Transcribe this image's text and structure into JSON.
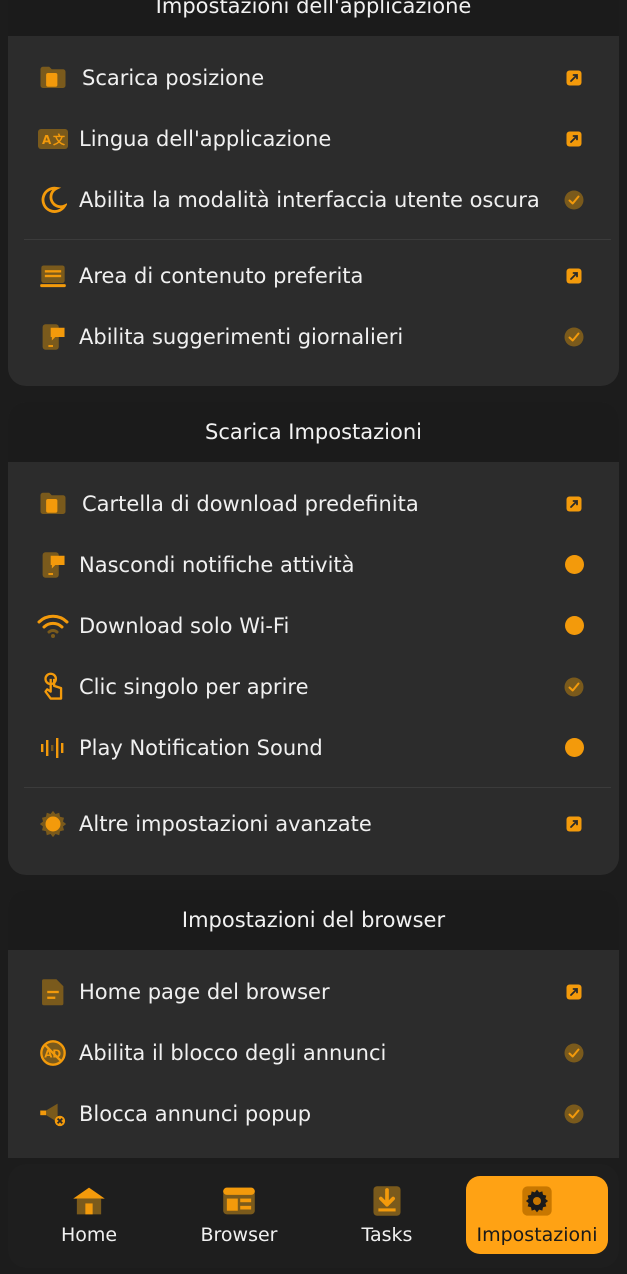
{
  "app_settings": {
    "header": "Impostazioni dell'applicazione",
    "items": [
      {
        "label": "Scarica posizione",
        "icon": "folder-icon",
        "action": "edit"
      },
      {
        "label": "Lingua dell'applicazione",
        "icon": "translate-icon",
        "action": "edit"
      },
      {
        "label": "Abilita la modalità interfaccia utente oscura",
        "icon": "moon-icon",
        "action": "check"
      },
      {
        "label": "Area di contenuto preferita",
        "icon": "content-area-icon",
        "action": "edit"
      },
      {
        "label": "Abilita suggerimenti giornalieri",
        "icon": "phone-tips-icon",
        "action": "check"
      }
    ]
  },
  "download_settings": {
    "header": "Scarica Impostazioni",
    "items": [
      {
        "label": "Cartella di download predefinita",
        "icon": "folder-icon",
        "action": "edit"
      },
      {
        "label": "Nascondi notifiche attività",
        "icon": "phone-notification-icon",
        "action": "dot"
      },
      {
        "label": "Download solo Wi-Fi",
        "icon": "wifi-icon",
        "action": "dot"
      },
      {
        "label": "Clic singolo per aprire",
        "icon": "tap-icon",
        "action": "check"
      },
      {
        "label": "Play Notification Sound",
        "icon": "sound-wave-icon",
        "action": "dot"
      },
      {
        "label": "Altre impostazioni avanzate",
        "icon": "gear-icon",
        "action": "edit"
      }
    ]
  },
  "browser_settings": {
    "header": "Impostazioni del browser",
    "items": [
      {
        "label": "Home page del browser",
        "icon": "document-icon",
        "action": "edit"
      },
      {
        "label": "Abilita il blocco degli annunci",
        "icon": "ad-block-icon",
        "action": "check"
      },
      {
        "label": "Blocca annunci popup",
        "icon": "megaphone-block-icon",
        "action": "check"
      }
    ]
  },
  "nav": {
    "items": [
      {
        "label": "Home",
        "icon": "home-icon"
      },
      {
        "label": "Browser",
        "icon": "browser-icon"
      },
      {
        "label": "Tasks",
        "icon": "download-tasks-icon"
      },
      {
        "label": "Impostazioni",
        "icon": "gear-icon",
        "active": true
      }
    ]
  },
  "colors": {
    "accent": "#f39a0b",
    "card": "#2c2c2c",
    "background": "#1c1c1c"
  }
}
